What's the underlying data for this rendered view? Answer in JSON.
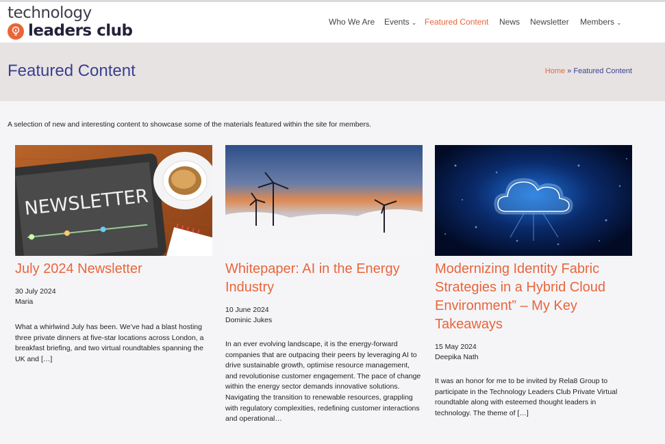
{
  "header": {
    "logo_top": "technology",
    "logo_bottom": "leaders club",
    "nav": [
      {
        "label": "Who We Are",
        "dropdown": false
      },
      {
        "label": "Events",
        "dropdown": true
      },
      {
        "label": "Featured Content",
        "dropdown": false,
        "active": true
      },
      {
        "label": "News",
        "dropdown": false
      },
      {
        "label": "Newsletter",
        "dropdown": false
      },
      {
        "label": "Members",
        "dropdown": true
      }
    ]
  },
  "hero": {
    "title": "Featured Content",
    "breadcrumb": {
      "home": "Home",
      "separator": "»",
      "current": "Featured Content"
    }
  },
  "intro": "A selection of new and interesting content to showcase some of the materials featured within the site for members.",
  "cards": [
    {
      "title": "July 2024 Newsletter",
      "date": "30 July 2024",
      "author": "Maria",
      "excerpt": "What a whirlwind July has been. We’ve had a blast hosting three private dinners at five-star locations across London, a breakfast briefing, and two virtual roundtables spanning the UK and […]",
      "image_text": "NEWSLETTER"
    },
    {
      "title": "Whitepaper: AI in the Energy Industry",
      "date": "10 June 2024",
      "author": "Dominic Jukes",
      "excerpt": "In an ever evolving landscape, it is the energy-forward companies that are outpacing their peers by leveraging AI to drive sustainable growth, optimise resource management, and revolutionise customer engagement. The pace of change within the energy sector demands innovative solutions. Navigating the transition to renewable resources, grappling with regulatory complexities, redefining customer interactions and operational…"
    },
    {
      "title": "Modernizing Identity Fabric Strategies in a Hybrid Cloud Environment” – My Key Takeaways",
      "date": "15 May 2024",
      "author": "Deepika Nath",
      "excerpt": "It was an honor for me to be invited by Rela8 Group to participate in the Technology Leaders Club Private Virtual roundtable along with esteemed thought leaders in technology.  The theme of […]"
    }
  ],
  "colors": {
    "accent": "#e9653a",
    "title_blue": "#3a3f8f",
    "hero_bg": "#e7e3e3"
  }
}
